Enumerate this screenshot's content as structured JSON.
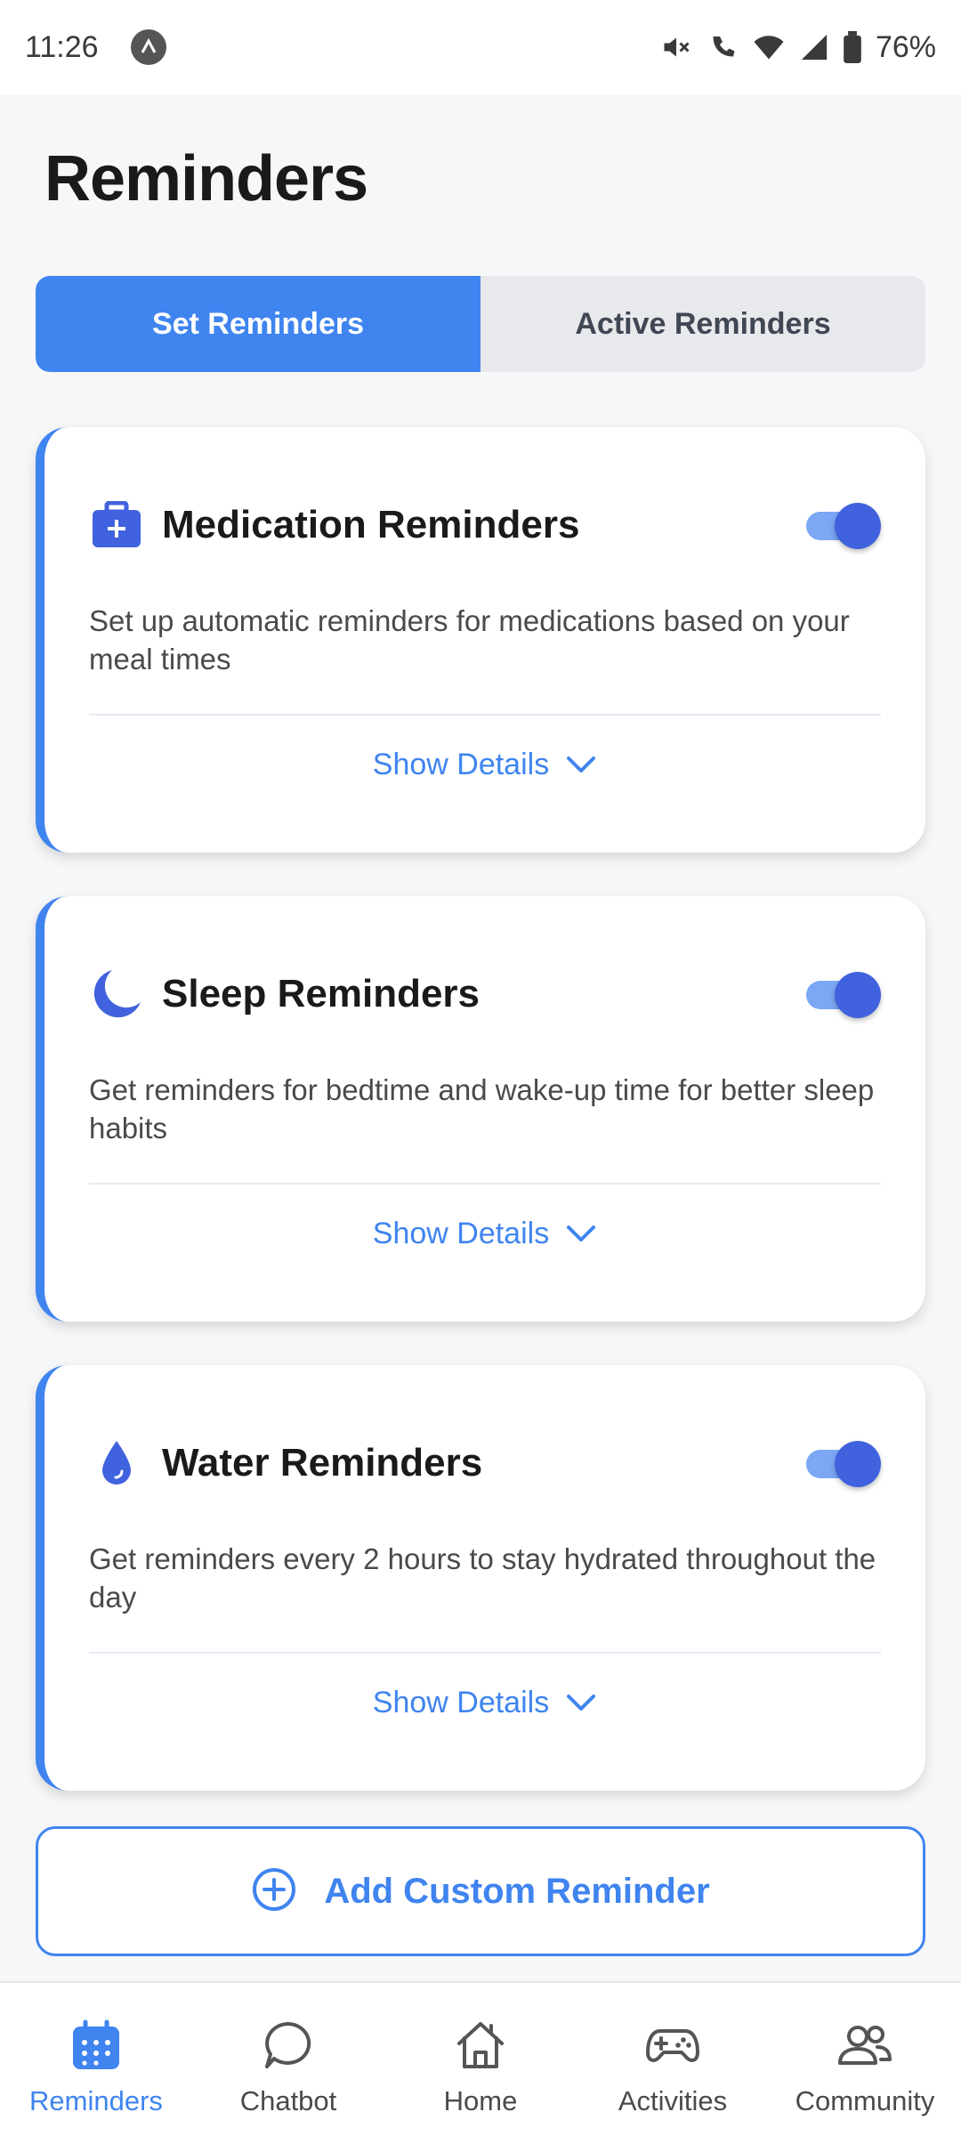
{
  "status_bar": {
    "time": "11:26",
    "battery": "76%",
    "icons": [
      "app-badge-icon",
      "mute-icon",
      "wifi-call-icon",
      "wifi-icon",
      "signal-icon",
      "battery-icon"
    ]
  },
  "page_title": "Reminders",
  "tabs": [
    {
      "label": "Set Reminders",
      "active": true
    },
    {
      "label": "Active Reminders",
      "active": false
    }
  ],
  "cards": [
    {
      "icon": "medical-kit-icon",
      "title": "Medication Reminders",
      "description": "Set up automatic reminders for medications based on your meal times",
      "enabled": true,
      "details_label": "Show Details"
    },
    {
      "icon": "moon-icon",
      "title": "Sleep Reminders",
      "description": "Get reminders for bedtime and wake-up time for better sleep habits",
      "enabled": true,
      "details_label": "Show Details"
    },
    {
      "icon": "water-drop-icon",
      "title": "Water Reminders",
      "description": "Get reminders every 2 hours to stay hydrated throughout the day",
      "enabled": true,
      "details_label": "Show Details"
    }
  ],
  "add_button": {
    "label": "Add Custom Reminder",
    "icon": "plus-circle-icon"
  },
  "bottom_nav": [
    {
      "label": "Reminders",
      "icon": "calendar-icon",
      "active": true
    },
    {
      "label": "Chatbot",
      "icon": "chat-icon",
      "active": false
    },
    {
      "label": "Home",
      "icon": "home-icon",
      "active": false
    },
    {
      "label": "Activities",
      "icon": "gamepad-icon",
      "active": false
    },
    {
      "label": "Community",
      "icon": "people-icon",
      "active": false
    }
  ],
  "colors": {
    "accent": "#3F84EF",
    "toggle_thumb": "#4062DE",
    "icon": "#4062DE",
    "background": "#F6F7F9"
  }
}
